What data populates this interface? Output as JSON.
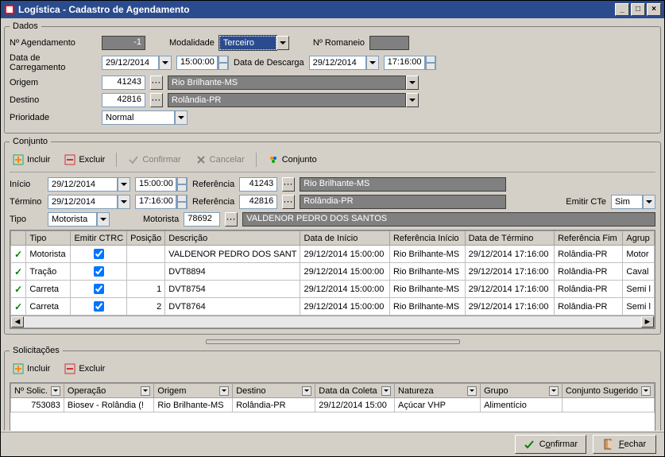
{
  "window": {
    "title": "Logística - Cadastro de Agendamento"
  },
  "dados": {
    "legend": "Dados",
    "numero_label": "Nº Agendamento",
    "numero_value": "-1",
    "modalidade_label": "Modalidade",
    "modalidade_value": "Terceiro",
    "romaneio_label": "Nº Romaneio",
    "romaneio_value": "",
    "data_carreg_label": "Data de Carregamento",
    "data_carreg_date": "29/12/2014",
    "data_carreg_time": "15:00:00",
    "data_descarga_label": "Data de Descarga",
    "data_descarga_date": "29/12/2014",
    "data_descarga_time": "17:16:00",
    "origem_label": "Origem",
    "origem_cod": "41243",
    "origem_desc": "Rio Brilhante-MS",
    "destino_label": "Destino",
    "destino_cod": "42816",
    "destino_desc": "Rolândia-PR",
    "prioridade_label": "Prioridade",
    "prioridade_value": "Normal"
  },
  "conjunto": {
    "legend": "Conjunto",
    "btn_incluir": "Incluir",
    "btn_excluir": "Excluir",
    "btn_confirmar": "Confirmar",
    "btn_cancelar": "Cancelar",
    "btn_conjunto": "Conjunto",
    "inicio_label": "Início",
    "inicio_date": "29/12/2014",
    "inicio_time": "15:00:00",
    "ref1_label": "Referência",
    "ref1_cod": "41243",
    "ref1_desc": "Rio Brilhante-MS",
    "termino_label": "Término",
    "termino_date": "29/12/2014",
    "termino_time": "17:16:00",
    "ref2_label": "Referência",
    "ref2_cod": "42816",
    "ref2_desc": "Rolândia-PR",
    "emitir_cte_label": "Emitir CTe",
    "emitir_cte_value": "Sim",
    "tipo_label": "Tipo",
    "tipo_value": "Motorista",
    "motorista_label": "Motorista",
    "motorista_cod": "78692",
    "motorista_desc": "VALDENOR PEDRO DOS SANTOS",
    "columns": [
      "Tipo",
      "Emitir CTRC",
      "Posição",
      "Descrição",
      "Data de Início",
      "Referência Início",
      "Data de Término",
      "Referência Fim",
      "Agrup"
    ],
    "rows": [
      {
        "tipo": "Motorista",
        "ctrc": true,
        "pos": "",
        "desc": "VALDENOR PEDRO DOS SANT",
        "inicio": "29/12/2014 15:00:00",
        "ref_i": "Rio Brilhante-MS",
        "termino": "29/12/2014 17:16:00",
        "ref_f": "Rolândia-PR",
        "agr": "Motor"
      },
      {
        "tipo": "Tração",
        "ctrc": true,
        "pos": "",
        "desc": "DVT8894",
        "inicio": "29/12/2014 15:00:00",
        "ref_i": "Rio Brilhante-MS",
        "termino": "29/12/2014 17:16:00",
        "ref_f": "Rolândia-PR",
        "agr": "Caval"
      },
      {
        "tipo": "Carreta",
        "ctrc": true,
        "pos": "1",
        "desc": "DVT8754",
        "inicio": "29/12/2014 15:00:00",
        "ref_i": "Rio Brilhante-MS",
        "termino": "29/12/2014 17:16:00",
        "ref_f": "Rolândia-PR",
        "agr": "Semi l"
      },
      {
        "tipo": "Carreta",
        "ctrc": true,
        "pos": "2",
        "desc": "DVT8764",
        "inicio": "29/12/2014 15:00:00",
        "ref_i": "Rio Brilhante-MS",
        "termino": "29/12/2014 17:16:00",
        "ref_f": "Rolândia-PR",
        "agr": "Semi l"
      }
    ]
  },
  "solic": {
    "legend": "Solicitações",
    "btn_incluir": "Incluir",
    "btn_excluir": "Excluir",
    "columns": [
      "Nº Solic.",
      "Operação",
      "Origem",
      "Destino",
      "Data da Coleta",
      "Natureza",
      "Grupo",
      "Conjunto Sugerido"
    ],
    "rows": [
      {
        "num": "753083",
        "op": "Biosev - Rolândia (!",
        "orig": "Rio Brilhante-MS",
        "dest": "Rolândia-PR",
        "data": "29/12/2014 15:00",
        "nat": "Açúcar VHP",
        "grupo": "Alimentício",
        "conj": ""
      }
    ]
  },
  "footer": {
    "confirmar_pre": "C",
    "confirmar_u": "o",
    "confirmar_post": "nfirmar",
    "fechar_pre": "",
    "fechar_u": "F",
    "fechar_post": "echar"
  },
  "icons": {
    "dots": "···"
  }
}
